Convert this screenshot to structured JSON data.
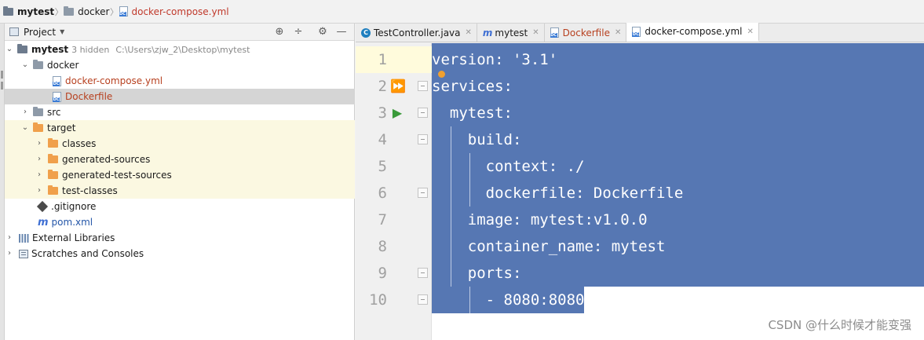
{
  "breadcrumb": {
    "project": "mytest",
    "folder": "docker",
    "file": "docker-compose.yml"
  },
  "project_panel": {
    "title": "Project",
    "tree": {
      "root_name": "mytest",
      "root_hint": "3 hidden",
      "root_path": "C:\\Users\\zjw_2\\Desktop\\mytest",
      "docker": "docker",
      "docker_compose": "docker-compose.yml",
      "dockerfile": "Dockerfile",
      "src": "src",
      "target": "target",
      "classes": "classes",
      "generated_sources": "generated-sources",
      "generated_test_sources": "generated-test-sources",
      "test_classes": "test-classes",
      "gitignore": ".gitignore",
      "pom": "pom.xml",
      "external_libraries": "External Libraries",
      "scratches": "Scratches and Consoles"
    }
  },
  "tabs": [
    {
      "label": "TestController.java"
    },
    {
      "label": "mytest"
    },
    {
      "label": "Dockerfile"
    },
    {
      "label": "docker-compose.yml"
    }
  ],
  "editor": {
    "line_numbers": [
      "1",
      "2",
      "3",
      "4",
      "5",
      "6",
      "7",
      "8",
      "9",
      "10"
    ],
    "lines": [
      "version: '3.1'",
      "services:",
      "  mytest:",
      "    build:",
      "      context: ./",
      "      dockerfile: Dockerfile",
      "    image: mytest:v1.0.0",
      "    container_name: mytest",
      "    ports:",
      "      - 8080:8080"
    ]
  },
  "watermark": "CSDN @什么时候才能变强",
  "colors": {
    "selection": "#5677b3",
    "excluded_bg": "#fbf8e1",
    "red_file": "#b7401f",
    "run_green": "#3a9a3a"
  }
}
